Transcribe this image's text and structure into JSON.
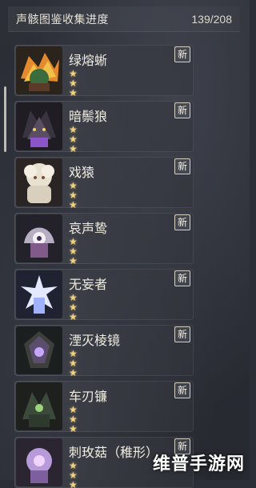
{
  "header": {
    "title": "声骸图鉴收集进度",
    "progress": "139/208"
  },
  "items": [
    {
      "name": "绿熔蜥",
      "stars": "★ ★ ★",
      "badge": "新",
      "accent": "#f3a73a"
    },
    {
      "name": "暗鬃狼",
      "stars": "★ ★ ★",
      "badge": "新",
      "accent": "#8b54c9"
    },
    {
      "name": "戏猿",
      "stars": "★ ★ ★",
      "badge": "新",
      "accent": "#e3dcc8"
    },
    {
      "name": "哀声鸷",
      "stars": "★ ★ ★",
      "badge": "新",
      "accent": "#9a6fb3"
    },
    {
      "name": "无妄者",
      "stars": "★ ★ ★",
      "badge": "新",
      "accent": "#cfd6ff"
    },
    {
      "name": "湮灭棱镜",
      "stars": "★ ★ ★",
      "badge": "新",
      "accent": "#7c4bb5"
    },
    {
      "name": "车刃镰",
      "stars": "★ ★ ★",
      "badge": "新",
      "accent": "#6fb36f"
    },
    {
      "name": "刺玫菇（稚形）",
      "stars": "★ ★ ★",
      "badge": "新",
      "accent": "#b79ad8"
    }
  ],
  "watermark": "维普手游网"
}
